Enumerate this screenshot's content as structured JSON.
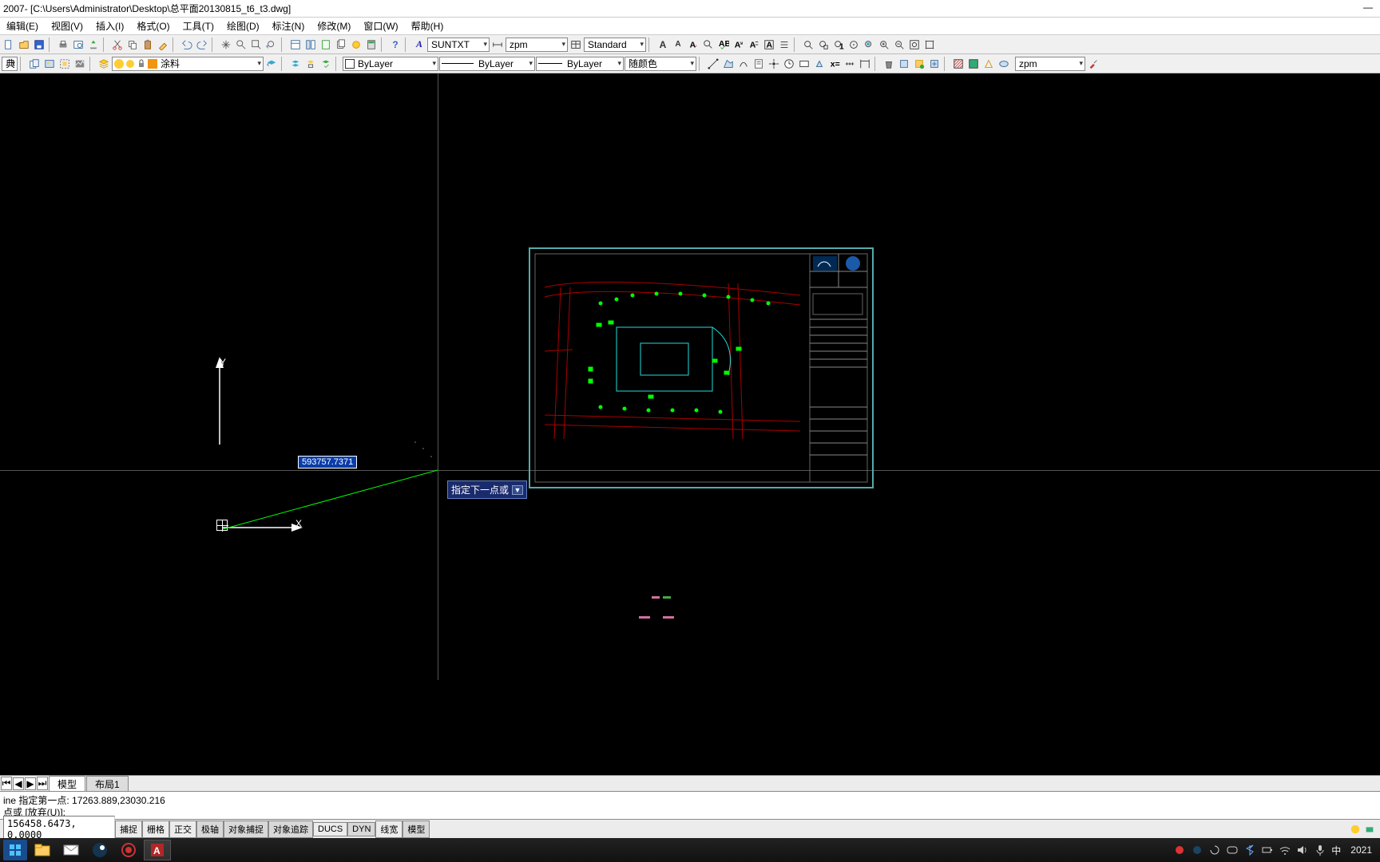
{
  "title_bar": {
    "app_version": "2007",
    "file_path": " - [C:\\Users\\Administrator\\Desktop\\总平面20130815_t6_t3.dwg]"
  },
  "menu": {
    "edit": "编辑(E)",
    "view": "视图(V)",
    "insert": "插入(I)",
    "format": "格式(O)",
    "tools": "工具(T)",
    "draw": "绘图(D)",
    "dimension": "标注(N)",
    "modify": "修改(M)",
    "window": "窗口(W)",
    "help": "帮助(H)"
  },
  "toolbar1": {
    "font_style": "SUNTXT",
    "dim_style": "zpm",
    "table_style": "Standard"
  },
  "toolbar2": {
    "layer_combo_label": "",
    "layer_bylayer": "ByLayer",
    "linetype": "ByLayer",
    "lineweight": "ByLayer",
    "color_label": "随颜色",
    "extra_label": "涂料",
    "right_combo": "zpm"
  },
  "canvas": {
    "ucs_y": "Y",
    "ucs_x": "X",
    "dyn_input_value": "593757.7371",
    "dyn_tip_text": "指定下一点或"
  },
  "tabs": {
    "model": "模型",
    "layout1": "布局1"
  },
  "command": {
    "history1": "ine 指定第一点: 17263.889,23030.216",
    "prompt_line": "点或 [放弃(U)]:"
  },
  "status": {
    "coords": "156458.6473, 0.0000",
    "toggles": {
      "snap": "捕捉",
      "grid": "栅格",
      "ortho": "正交",
      "polar": "极轴",
      "osnap": "对象捕捉",
      "otrack": "对象追踪",
      "ducs": "DUCS",
      "dyn": "DYN",
      "lwt": "线宽",
      "model": "模型"
    }
  },
  "system_tray": {
    "year": "2021",
    "ime": "中"
  }
}
